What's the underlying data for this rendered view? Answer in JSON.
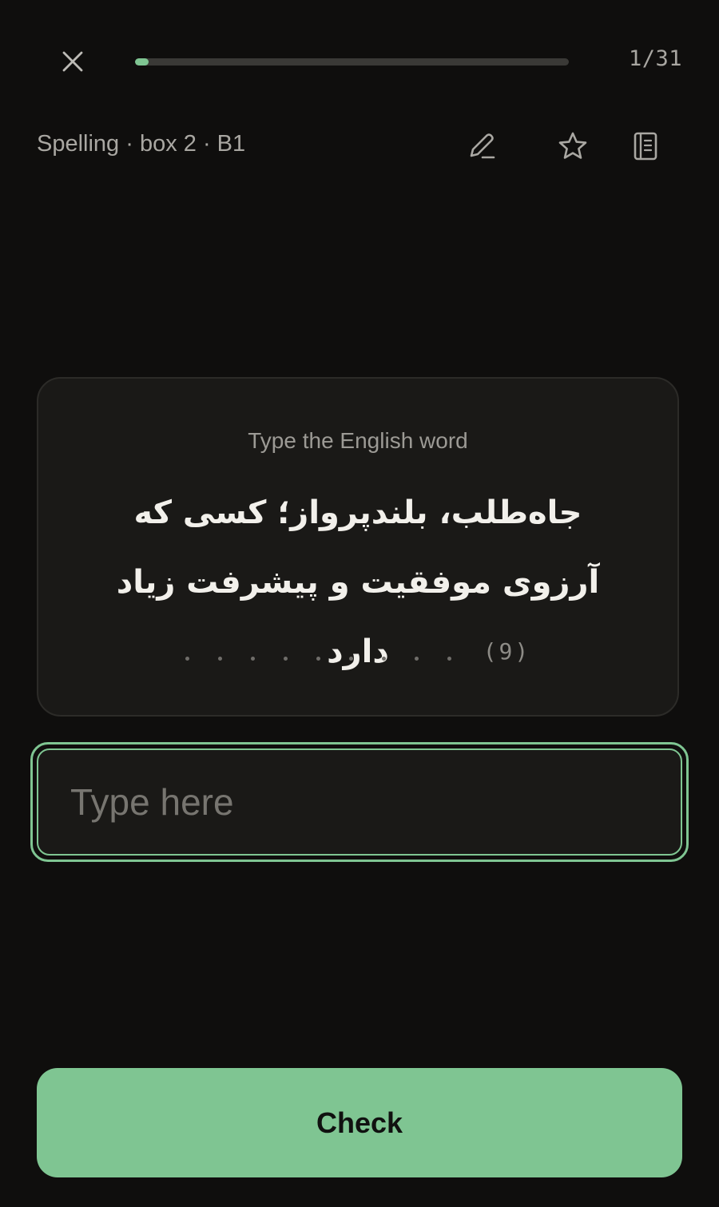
{
  "header": {
    "close_icon": "close-icon",
    "progress_fraction": 0.032,
    "counter": "1/31"
  },
  "meta": {
    "label": "Spelling · box 2 · B1",
    "icons": [
      "pencil-icon",
      "star-icon",
      "notebook-icon"
    ]
  },
  "card": {
    "instruction": "Type the English word",
    "prompt": "جاه‌طلب، بلندپرواز؛ کسی که آرزوی موفقیت و پیشرفت زیاد دارد",
    "letter_slots": 9,
    "letter_count": "(9)"
  },
  "answer": {
    "placeholder": "Type here",
    "value": ""
  },
  "actions": {
    "check_label": "Check"
  },
  "colors": {
    "background": "#0f0e0d",
    "accent": "#7fc592",
    "card": "#1a1917",
    "muted_text": "#a9a7a2"
  }
}
